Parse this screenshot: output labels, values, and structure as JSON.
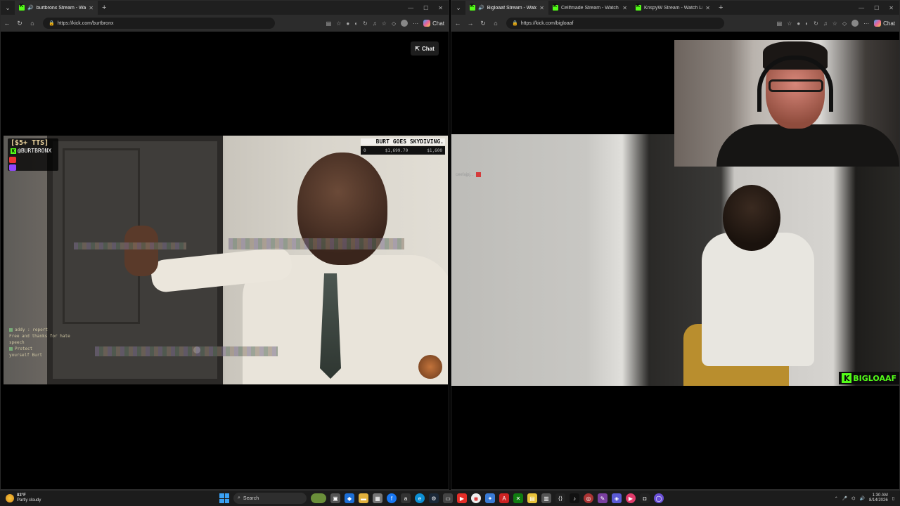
{
  "left_window": {
    "tabs": [
      {
        "title": "burtbronx Stream - Watch Live on Kick",
        "active": true
      }
    ],
    "url": "https://kick.com/burtbronx",
    "chat_button": "Chat",
    "toolbar_chat": "Chat",
    "overlay": {
      "tts_label": "[$5+ TTS]",
      "handle": "@BURTBRONX",
      "goal_title": "BURT GOES SKYDIVING.",
      "goal_start": "0",
      "goal_current": "$1,699.70",
      "goal_target": "$1,600",
      "chat_lines": [
        {
          "user": "addy",
          "text": "addy : report"
        },
        {
          "user": "",
          "text": "Free and thanks for hate"
        },
        {
          "user": "",
          "text": "speech"
        },
        {
          "user": "",
          "text": "Protect"
        },
        {
          "user": "",
          "text": "yourself Burt"
        }
      ]
    }
  },
  "right_window": {
    "tabs": [
      {
        "title": "Bigloaaf Stream - Watch Live on Kick",
        "active": true
      },
      {
        "title": "Cellfmade Stream - Watch Live on Kick",
        "active": false
      },
      {
        "title": "KrispyW Stream - Watch Live on Kick",
        "active": false
      }
    ],
    "url": "https://kick.com/bigloaaf",
    "toolbar_chat": "Chat",
    "overlay": {
      "logo_text": "BIGLOAAF",
      "alert_text": "ceefajpj..."
    }
  },
  "taskbar": {
    "weather_temp": "83°F",
    "weather_desc": "Partly cloudy",
    "search_placeholder": "Search",
    "time": "1:30 AM",
    "date": "8/14/2026"
  },
  "colors": {
    "kick_green": "#53fc18",
    "tab_bg": "#1f1f1f",
    "toolbar_bg": "#2c2c2c",
    "taskbar_bg": "#1c1c1c"
  }
}
